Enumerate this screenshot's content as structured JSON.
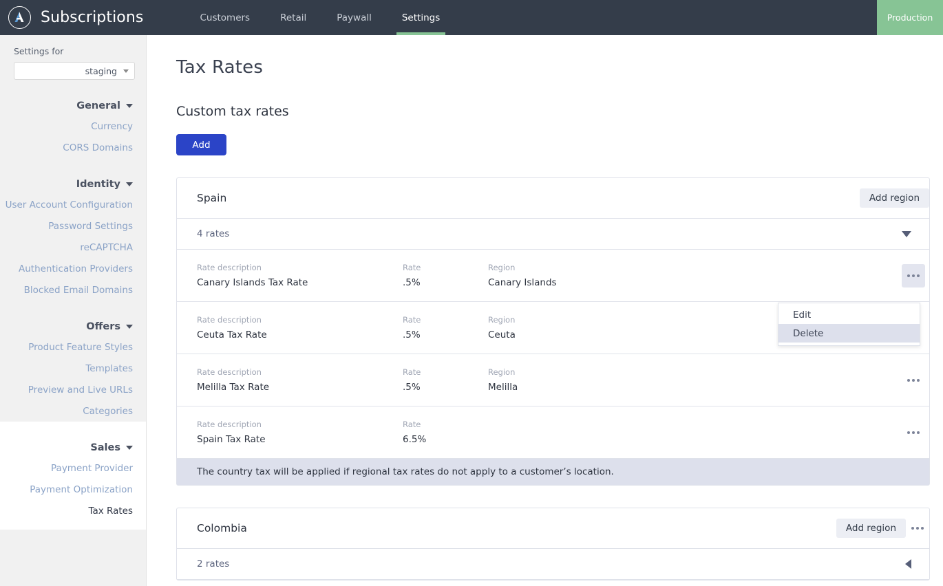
{
  "topbar": {
    "logo_icon": "apple-a-logo-icon",
    "app_title": "Subscriptions",
    "nav": [
      {
        "label": "Customers",
        "active": false
      },
      {
        "label": "Retail",
        "active": false
      },
      {
        "label": "Paywall",
        "active": false
      },
      {
        "label": "Settings",
        "active": true
      }
    ],
    "env_badge": "Production",
    "colors": {
      "bar": "#343d4a",
      "accent_green": "#87c495"
    }
  },
  "sidebar": {
    "settings_for_label": "Settings for",
    "env_select": {
      "value": "staging",
      "icon": "chevron-down-icon"
    },
    "sections": [
      {
        "title": "General",
        "links": [
          "Currency",
          "CORS Domains"
        ]
      },
      {
        "title": "Identity",
        "links": [
          "User Account Configuration",
          "Password Settings",
          "reCAPTCHA",
          "Authentication Providers",
          "Blocked Email Domains"
        ]
      },
      {
        "title": "Offers",
        "links": [
          "Product Feature Styles",
          "Templates",
          "Preview and Live URLs",
          "Categories"
        ]
      },
      {
        "title": "Sales",
        "links": [
          "Payment Provider",
          "Payment Optimization",
          "Tax Rates"
        ],
        "current": "Tax Rates"
      }
    ]
  },
  "main": {
    "page_title": "Tax Rates",
    "section_title": "Custom tax rates",
    "add_button": "Add",
    "column_headers": {
      "description": "Rate description",
      "rate": "Rate",
      "region": "Region"
    },
    "countries": [
      {
        "name": "Spain",
        "add_region_label": "Add region",
        "has_kebab": false,
        "rates_count": "4 rates",
        "expanded": true,
        "collapse_icon": "triangle-down-icon",
        "rates": [
          {
            "description": "Canary Islands Tax Rate",
            "rate": ".5%",
            "region": "Canary Islands",
            "menu_open": true
          },
          {
            "description": "Ceuta Tax Rate",
            "rate": ".5%",
            "region": "Ceuta",
            "menu_open": false
          },
          {
            "description": "Melilla Tax Rate",
            "rate": ".5%",
            "region": "Melilla",
            "menu_open": false
          },
          {
            "description": "Spain Tax Rate",
            "rate": "6.5%",
            "region": "",
            "menu_open": false
          }
        ],
        "note": "The country tax will be applied if regional tax rates do not apply to a customer’s location."
      },
      {
        "name": "Colombia",
        "add_region_label": "Add region",
        "has_kebab": true,
        "rates_count": "2 rates",
        "expanded": false,
        "collapse_icon": "triangle-left-icon",
        "rates": [],
        "note": ""
      }
    ],
    "row_menu": {
      "items": [
        {
          "label": "Edit",
          "highlighted": false
        },
        {
          "label": "Delete",
          "highlighted": true
        }
      ]
    },
    "colors": {
      "primary_button": "#2b44c7",
      "note_bg": "#dde0ec"
    }
  }
}
